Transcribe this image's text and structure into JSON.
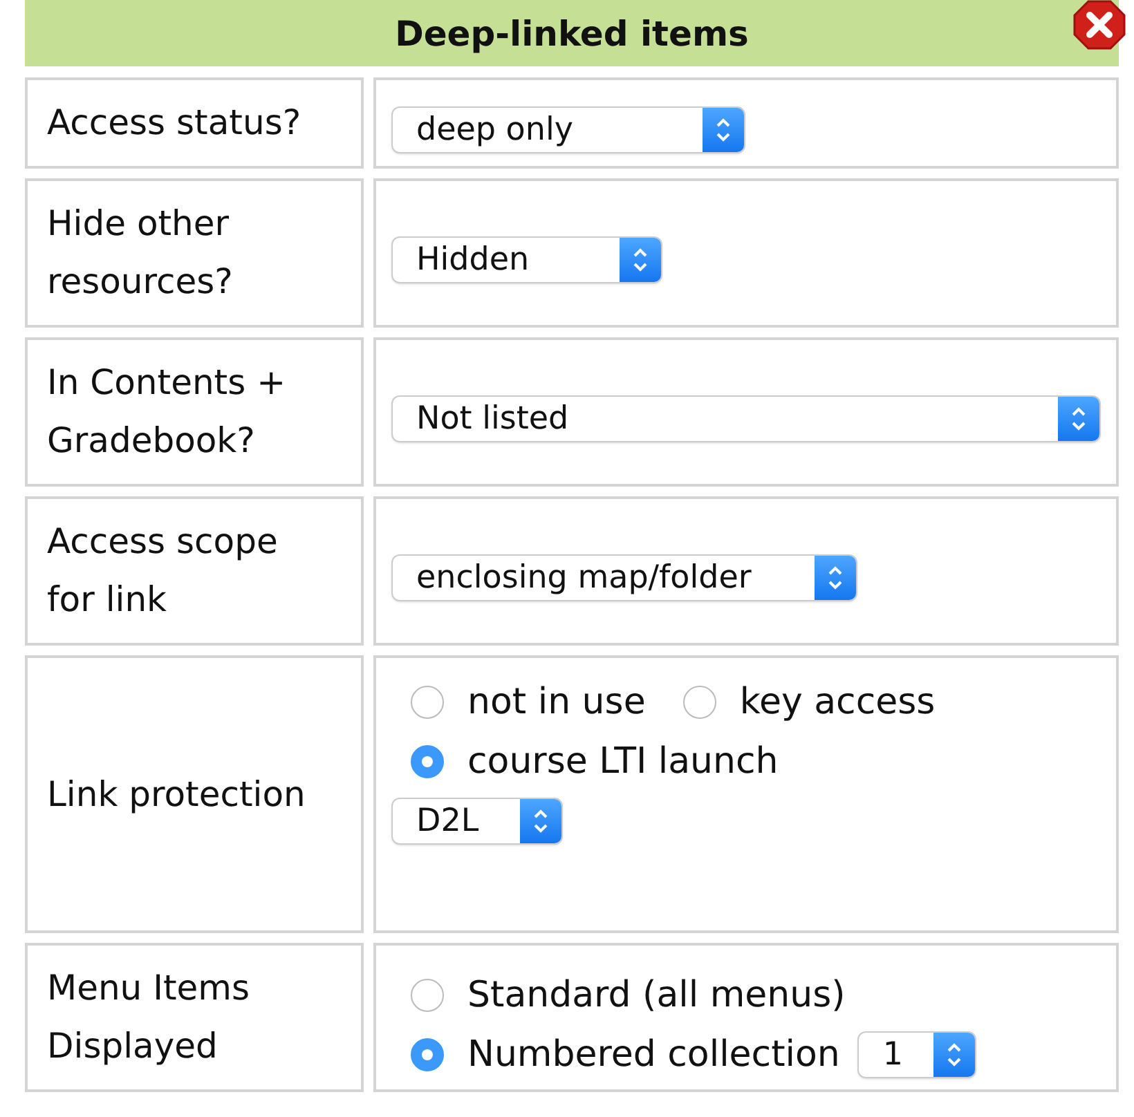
{
  "title": "Deep-linked items",
  "rows": [
    {
      "label": "Access status?",
      "lines": [
        [
          {
            "kind": "select",
            "value": "deep only"
          }
        ]
      ]
    },
    {
      "label": "Hide other resources?",
      "lines": [
        [
          {
            "kind": "select",
            "value": "Hidden"
          }
        ]
      ]
    },
    {
      "label": "In Contents + Gradebook?",
      "lines": [
        [
          {
            "kind": "select",
            "value": "Not listed"
          }
        ]
      ]
    },
    {
      "label": "Access scope for link",
      "lines": [
        [
          {
            "kind": "select",
            "value": "enclosing map/folder"
          }
        ]
      ]
    },
    {
      "label": "Link protection",
      "lines": [
        [
          {
            "kind": "radio",
            "label": "not in use",
            "selected": false
          },
          {
            "kind": "radio",
            "label": "key access",
            "selected": false
          }
        ],
        [
          {
            "kind": "radio",
            "label": "course LTI launch",
            "selected": true
          }
        ],
        [
          {
            "kind": "select",
            "value": "D2L"
          }
        ]
      ]
    },
    {
      "label": "Menu Items Displayed",
      "lines": [
        [
          {
            "kind": "radio",
            "label": "Standard (all menus)",
            "selected": false
          }
        ],
        [
          {
            "kind": "radio",
            "label": "Numbered collection",
            "selected": true
          },
          {
            "kind": "select",
            "value": "1"
          }
        ]
      ]
    }
  ]
}
